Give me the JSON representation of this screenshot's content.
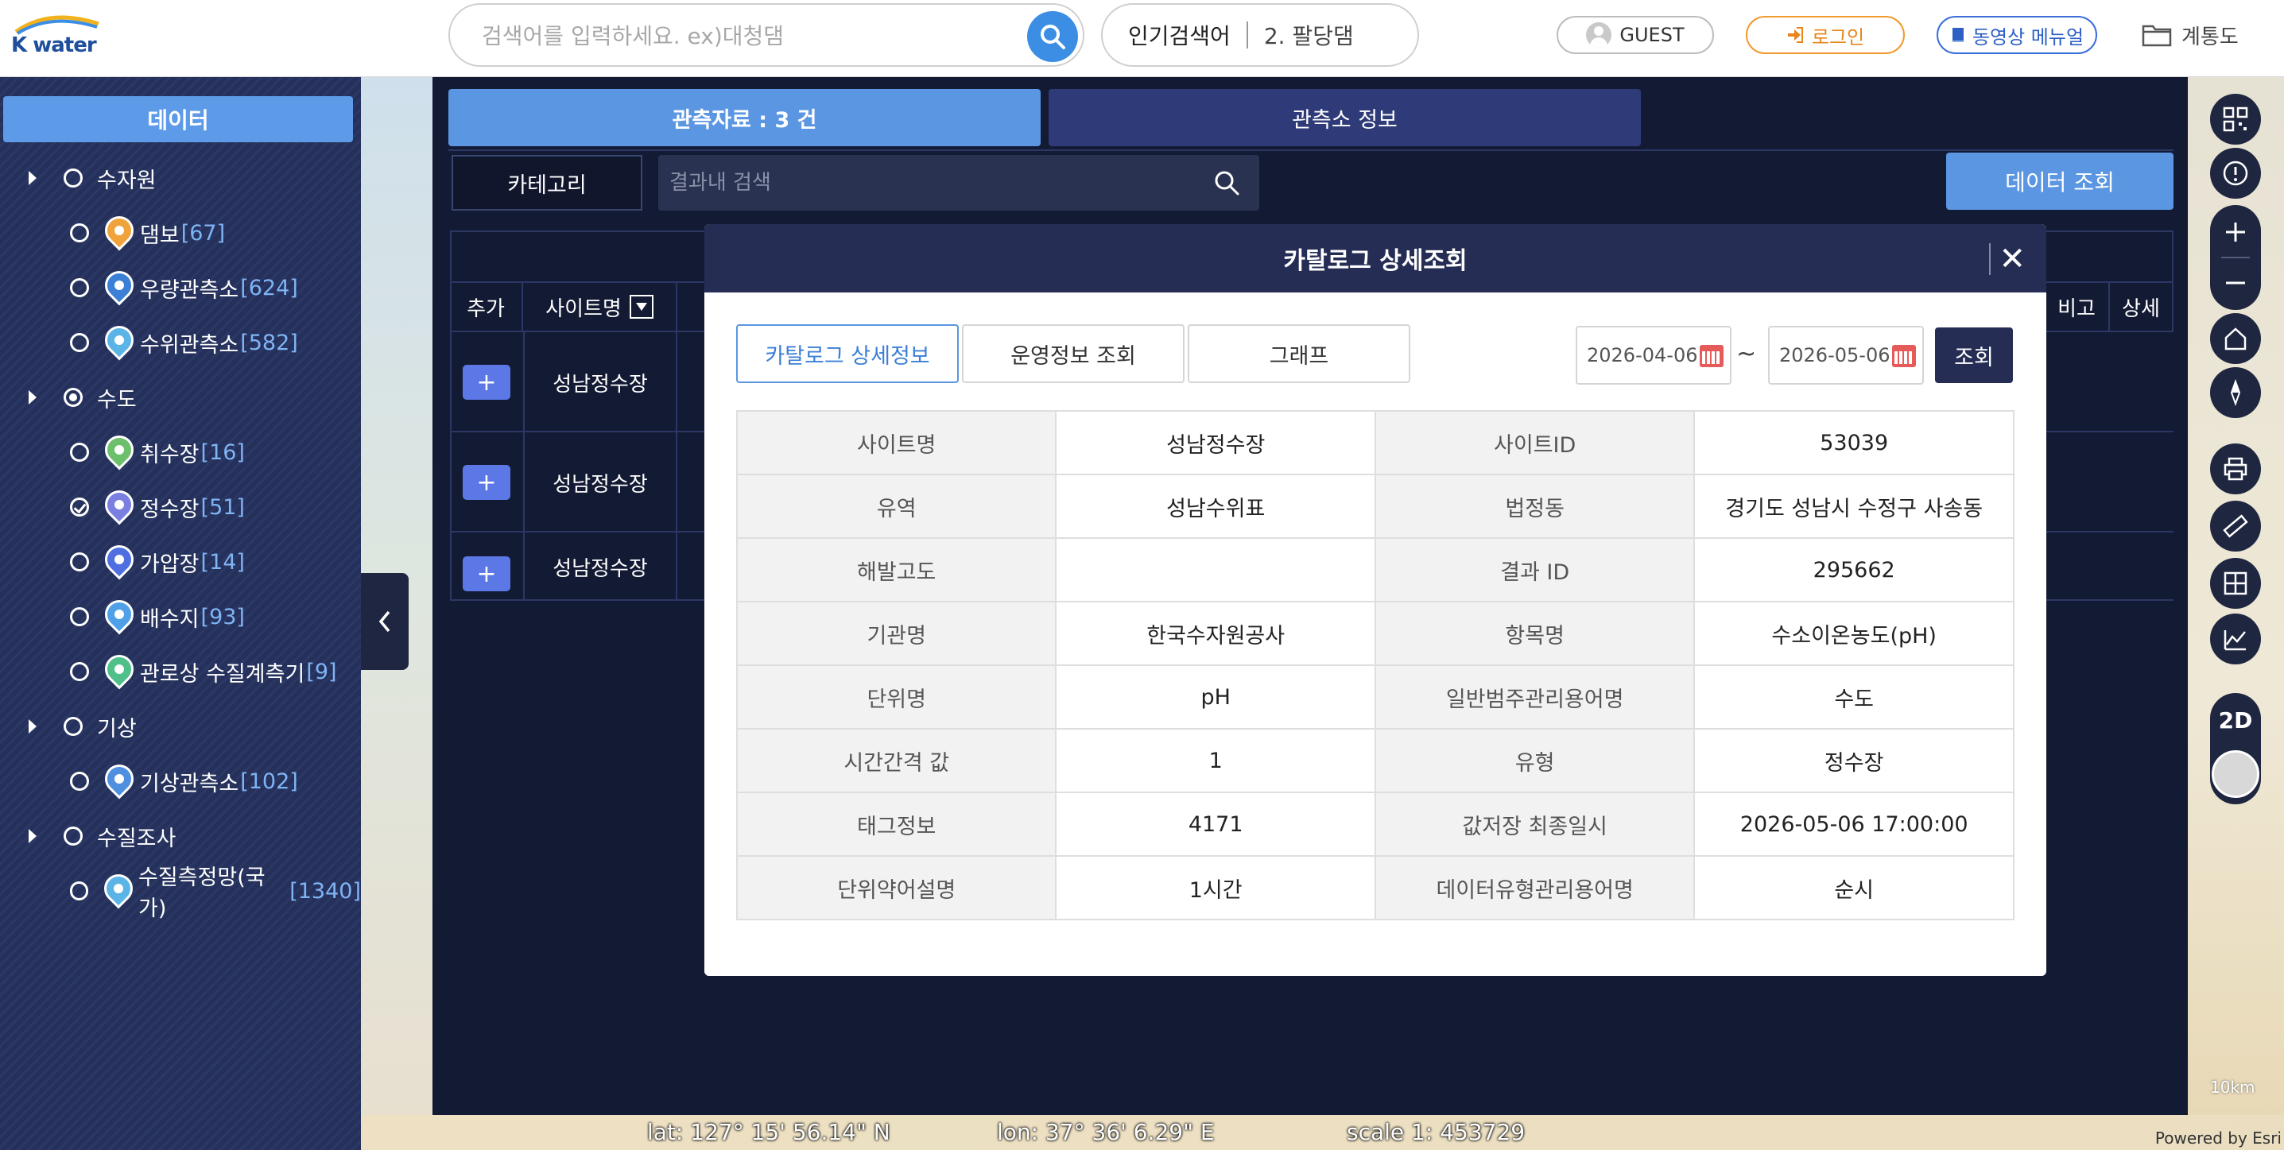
{
  "header": {
    "logo_text": "K water",
    "search_placeholder": "검색어를 입력하세요. ex)대청댐",
    "popular_label": "인기검색어",
    "popular_value": "2. 팔당댐",
    "guest_label": "GUEST",
    "login_label": "로그인",
    "manual_label": "동영상 메뉴얼",
    "folder_label": "계통도"
  },
  "sidebar": {
    "title": "데이터",
    "groups": [
      {
        "label": "수자원",
        "selected": false,
        "items": [
          {
            "label": "댐보",
            "count": "[67]",
            "color": "#f0a33a"
          },
          {
            "label": "우량관측소",
            "count": "[624]",
            "color": "#3b7fd6"
          },
          {
            "label": "수위관측소",
            "count": "[582]",
            "color": "#5ab4e6"
          }
        ]
      },
      {
        "label": "수도",
        "selected": true,
        "items": [
          {
            "label": "취수장",
            "count": "[16]",
            "color": "#6cc06c"
          },
          {
            "label": "정수장",
            "count": "[51]",
            "color": "#7b7fe0",
            "checked": true
          },
          {
            "label": "가압장",
            "count": "[14]",
            "color": "#4f6fe0"
          },
          {
            "label": "배수지",
            "count": "[93]",
            "color": "#4fa0e8"
          },
          {
            "label": "관로상 수질계측기",
            "count": "[9]",
            "color": "#4fc08a"
          }
        ]
      },
      {
        "label": "기상",
        "selected": false,
        "items": [
          {
            "label": "기상관측소",
            "count": "[102]",
            "color": "#4f8fe0"
          }
        ]
      },
      {
        "label": "수질조사",
        "selected": false,
        "items": [
          {
            "label": "수질측정망(국가)",
            "count": "[1340]",
            "color": "#5ab4e6"
          }
        ]
      }
    ]
  },
  "panel": {
    "tab_obs": "관측자료 : 3 건",
    "tab_station": "관측소 정보",
    "category_label": "카테고리",
    "result_search_placeholder": "결과내 검색",
    "data_query_label": "데이터 조회",
    "columns": {
      "add": "추가",
      "site": "사이트명",
      "note": "비고",
      "detail": "상세"
    },
    "rows": [
      {
        "add": "+",
        "site": "성남정수장"
      },
      {
        "add": "+",
        "site": "성남정수장"
      },
      {
        "add": "+",
        "site": "성남정수장"
      }
    ]
  },
  "modal": {
    "title": "카탈로그 상세조회",
    "close_label": "✕",
    "tabs": [
      "카탈로그 상세정보",
      "운영정보 조회",
      "그래프"
    ],
    "date_from": "2026-04-06",
    "date_to": "2026-05-06",
    "tilde": "~",
    "query_label": "조회",
    "rows": [
      [
        "사이트명",
        "성남정수장",
        "사이트ID",
        "53039"
      ],
      [
        "유역",
        "성남수위표",
        "법정동",
        "경기도 성남시 수정구 사송동"
      ],
      [
        "해발고도",
        "",
        "결과 ID",
        "295662"
      ],
      [
        "기관명",
        "한국수자원공사",
        "항목명",
        "수소이온농도(pH)"
      ],
      [
        "단위명",
        "pH",
        "일반범주관리용어명",
        "수도"
      ],
      [
        "시간간격 값",
        "1",
        "유형",
        "정수장"
      ],
      [
        "태그정보",
        "4171",
        "값저장 최종일시",
        "2026-05-06 17:00:00"
      ],
      [
        "단위약어설명",
        "1시간",
        "데이터유형관리용어명",
        "순시"
      ]
    ]
  },
  "map": {
    "mode_label": "2D",
    "scale_bar": "10km",
    "powered_by": "Powered by Esri"
  },
  "status": {
    "lat": "lat: 127° 15' 56.14\" N",
    "lon": "lon: 37° 36' 6.29\" E",
    "scale": "scale 1: 453729"
  }
}
